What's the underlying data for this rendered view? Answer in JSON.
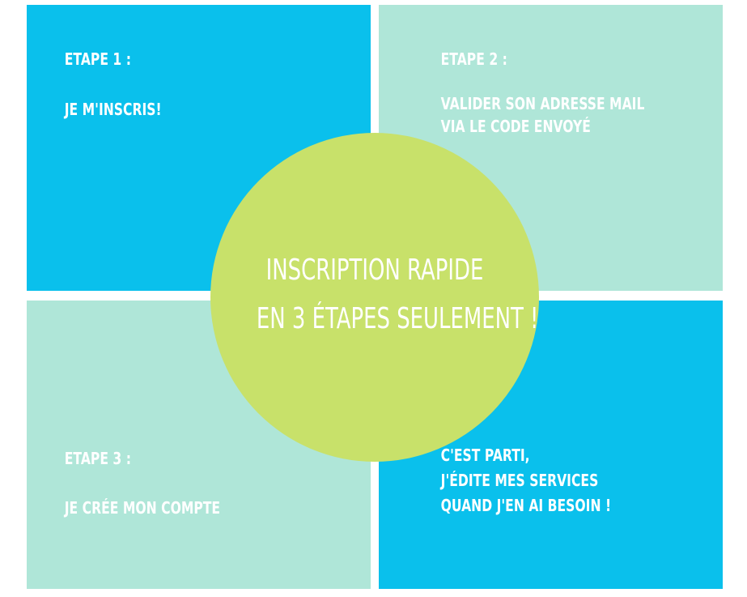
{
  "colors": {
    "blue": "#0ac0ec",
    "mint": "#afe6d8",
    "lime": "#c8e16a",
    "text": "#ffffff"
  },
  "center": {
    "line1": "INSCRIPTION RAPIDE",
    "line2": "EN 3 ÉTAPES SEULEMENT !"
  },
  "steps": [
    {
      "title": "ETAPE 1 :",
      "lines": [
        "JE M'INSCRIS!"
      ]
    },
    {
      "title": "ETAPE 2 :",
      "lines": [
        "VALIDER SON ADRESSE MAIL",
        "VIA LE CODE ENVOYÉ"
      ]
    },
    {
      "title": "ETAPE 3 :",
      "lines": [
        "JE CRÉE MON COMPTE"
      ]
    },
    {
      "title": "",
      "lines": [
        "C'EST PARTI,",
        "J'ÉDITE MES SERVICES",
        "QUAND J'EN AI BESOIN !"
      ]
    }
  ]
}
